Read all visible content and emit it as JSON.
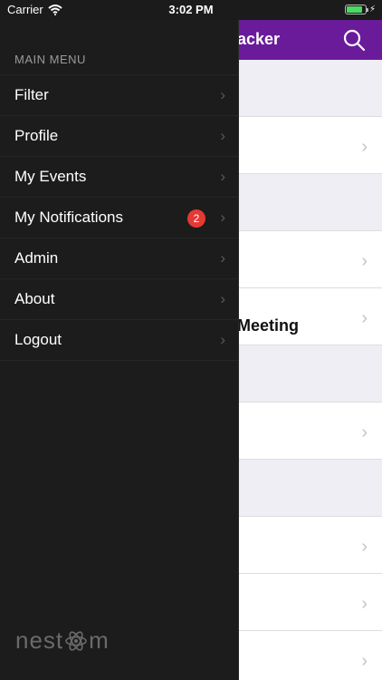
{
  "status_bar": {
    "carrier": "Carrier",
    "time": "3:02 PM",
    "battery_level": 0.85
  },
  "background": {
    "header_title_fragment": "acker",
    "rows": [
      {
        "type": "section",
        "text": ""
      },
      {
        "type": "item",
        "text": ""
      },
      {
        "type": "section",
        "text": ""
      },
      {
        "type": "item",
        "text": ""
      },
      {
        "type": "item",
        "text": "Meeting"
      },
      {
        "type": "section",
        "text": ""
      },
      {
        "type": "item",
        "text": ""
      },
      {
        "type": "section",
        "text": ""
      },
      {
        "type": "item",
        "text": ""
      },
      {
        "type": "item",
        "text": ""
      },
      {
        "type": "item",
        "text": ""
      }
    ]
  },
  "menu": {
    "header": "MAIN MENU",
    "items": [
      {
        "label": "Filter",
        "badge": ""
      },
      {
        "label": "Profile",
        "badge": ""
      },
      {
        "label": "My Events",
        "badge": ""
      },
      {
        "label": "My Notifications",
        "badge": "2"
      },
      {
        "label": "Admin",
        "badge": ""
      },
      {
        "label": "About",
        "badge": ""
      },
      {
        "label": "Logout",
        "badge": ""
      }
    ]
  },
  "brand": {
    "left": "nest",
    "right": "m"
  },
  "colors": {
    "header_purple": "#6a1b9a",
    "badge_red": "#e53935",
    "battery_green": "#4cd964"
  }
}
